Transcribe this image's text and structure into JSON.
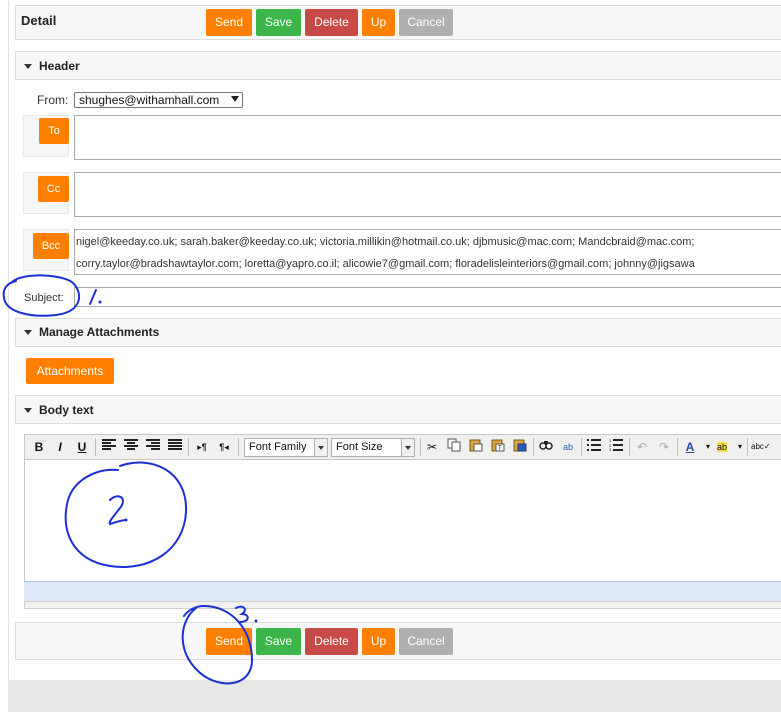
{
  "panel": {
    "title": "Detail"
  },
  "toolbar_top": {
    "send": "Send",
    "save": "Save",
    "delete": "Delete",
    "up": "Up",
    "cancel": "Cancel"
  },
  "toolbar_bottom": {
    "send": "Send",
    "save": "Save",
    "delete": "Delete",
    "up": "Up",
    "cancel": "Cancel"
  },
  "header_section": {
    "label": "Header",
    "from_label": "From:",
    "from_value": "shughes@withamhall.com",
    "to_button": "To",
    "to_value": "",
    "cc_button": "Cc",
    "cc_value": "",
    "bcc_button": "Bcc",
    "bcc_line1": "nigel@keeday.co.uk; sarah.baker@keeday.co.uk; victoria.millikin@hotmail.co.uk; djbmusic@mac.com; Mandcbraid@mac.com;",
    "bcc_line2": "corry.taylor@bradshawtaylor.com; loretta@yapro.co.il; alicowie7@gmail.com; floradelisleinteriors@gmail.com; johnny@jigsawa",
    "subject_label": "Subject:",
    "subject_value": ""
  },
  "attachments_section": {
    "label": "Manage Attachments",
    "button": "Attachments"
  },
  "body_section": {
    "label": "Body text",
    "font_family": "Font Family",
    "font_size": "Font Size",
    "editor_icons": [
      "bold-icon",
      "italic-icon",
      "underline-icon",
      "align-left-icon",
      "align-center-icon",
      "align-right-icon",
      "justify-icon",
      "ltr-icon",
      "rtl-icon",
      "cut-icon",
      "copy-icon",
      "paste-icon",
      "paste-text-icon",
      "paste-word-icon",
      "find-icon",
      "replace-icon",
      "bullet-list-icon",
      "numbered-list-icon",
      "undo-icon",
      "redo-icon",
      "font-color-icon",
      "highlight-icon",
      "spellcheck-icon"
    ]
  },
  "annotations": {
    "one": "1.",
    "two": "2.",
    "three": "3."
  },
  "colors": {
    "accent": "#ff8000",
    "save": "#3cb64a",
    "delete": "#c84a46",
    "cancel": "#b0b0b0",
    "annotation": "#1a2fd6"
  }
}
